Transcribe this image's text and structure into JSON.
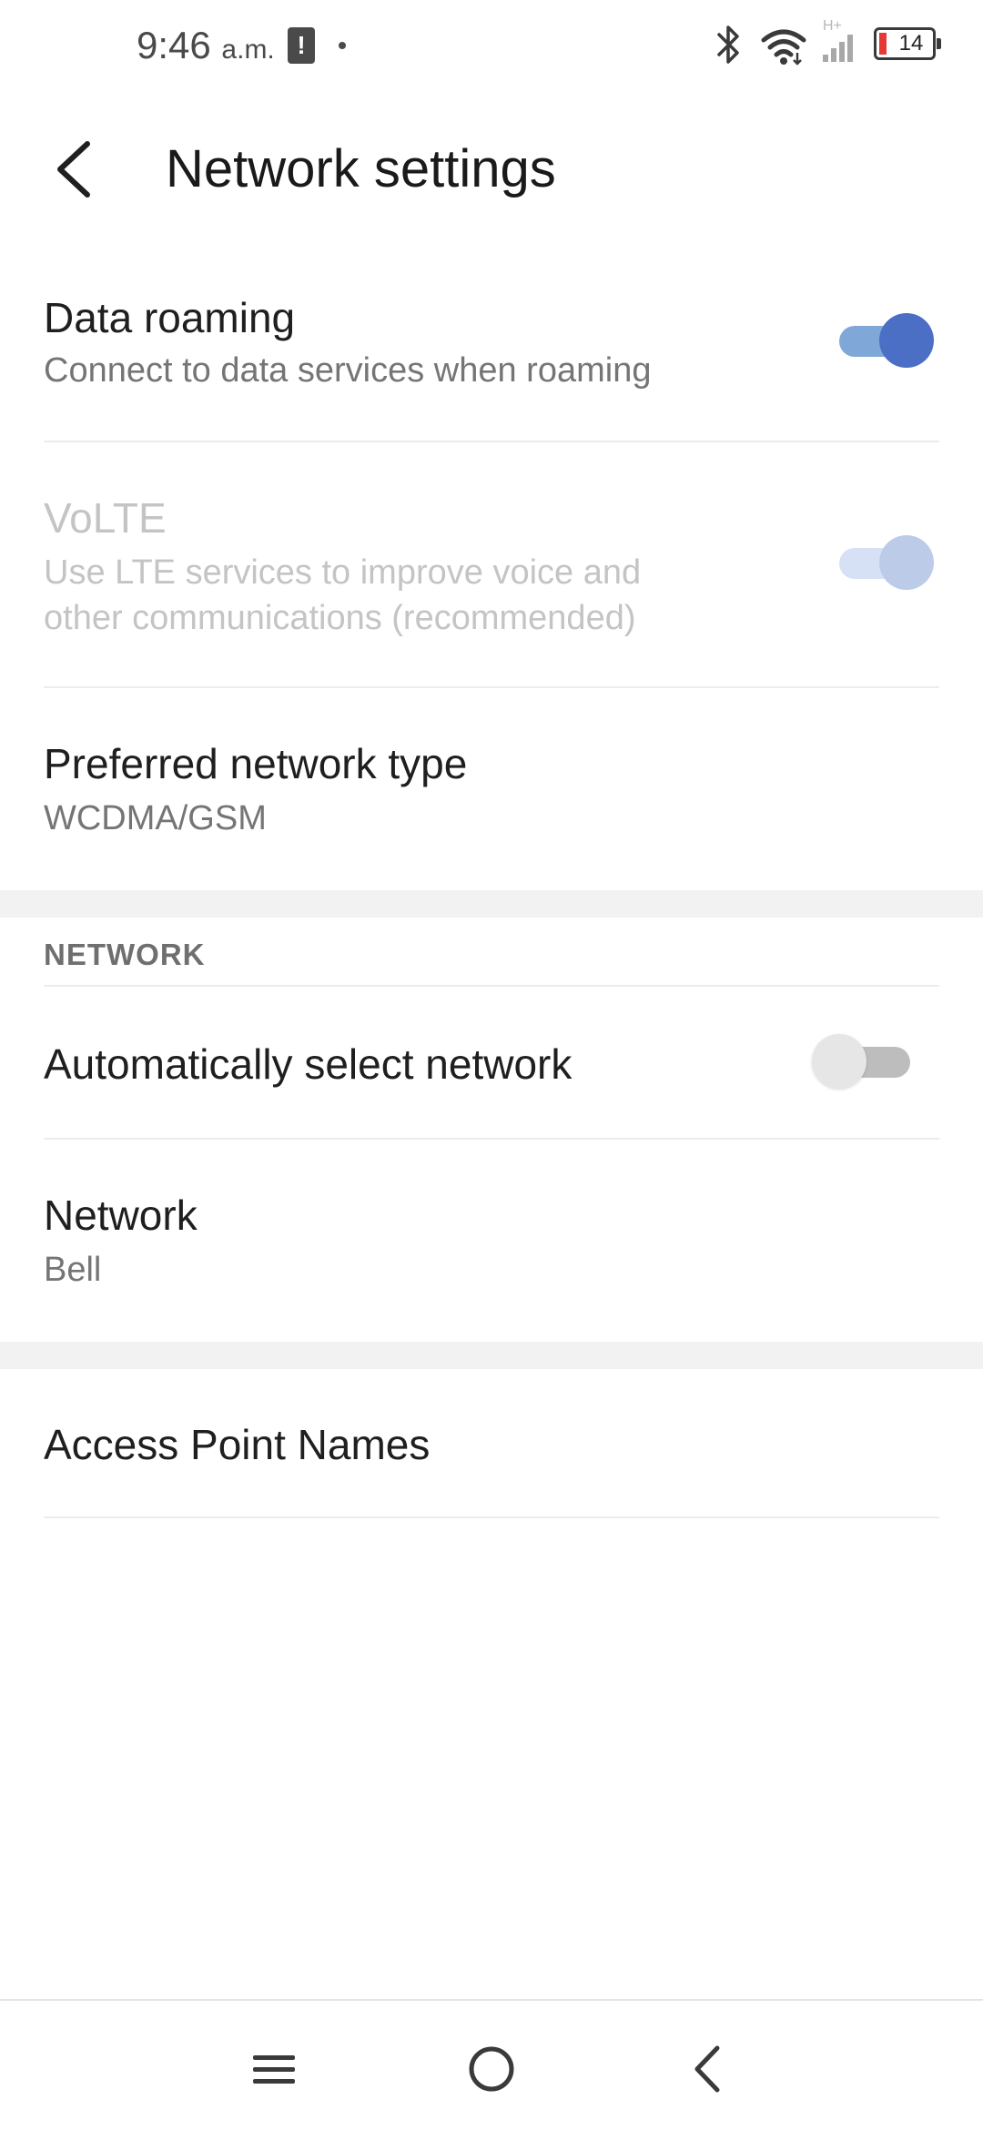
{
  "status_bar": {
    "time": "9:46",
    "ampm": "a.m.",
    "alert_glyph": "!",
    "network_tag": "H+",
    "battery_level": "14",
    "icons": [
      "alert-icon",
      "bluetooth-icon",
      "wifi-icon",
      "cell-signal-icon",
      "battery-icon"
    ]
  },
  "app_bar": {
    "title": "Network settings"
  },
  "settings": {
    "data_roaming": {
      "title": "Data roaming",
      "subtitle": "Connect to data services when roaming",
      "state": "on"
    },
    "volte": {
      "title": "VoLTE",
      "subtitle_line1": "Use LTE services to improve voice and",
      "subtitle_line2": "other communications (recommended)",
      "state": "on",
      "enabled": false
    },
    "preferred_network_type": {
      "title": "Preferred network type",
      "value": "WCDMA/GSM"
    }
  },
  "network_section": {
    "header": "NETWORK",
    "auto_select": {
      "title": "Automatically select network",
      "state": "off"
    },
    "network": {
      "title": "Network",
      "value": "Bell"
    }
  },
  "apn": {
    "title": "Access Point Names"
  },
  "nav_bar": {
    "icons": [
      "menu-icon",
      "home-circle-icon",
      "back-chevron-icon"
    ]
  },
  "colors": {
    "toggle_on_thumb": "#4a6fc4",
    "toggle_on_track": "#7fa8d8",
    "toggle_disabled_thumb": "#bccbe8",
    "toggle_disabled_track": "#d6e1f6",
    "toggle_off_thumb": "#e6e6e6",
    "toggle_off_track": "#bdbdbd",
    "section_gap": "#f2f2f2"
  }
}
